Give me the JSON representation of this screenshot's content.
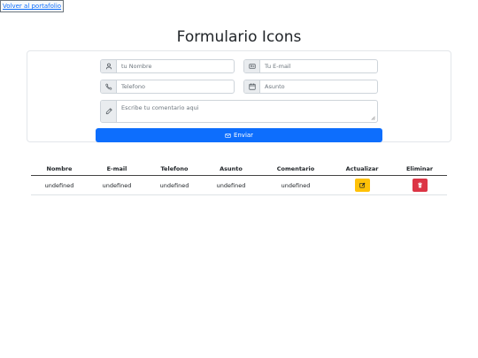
{
  "nav": {
    "back_label": "Volver al portafolio"
  },
  "page": {
    "title": "Formulario Icons"
  },
  "form": {
    "name_placeholder": "tu Nombre",
    "email_placeholder": "Tu E-mail",
    "phone_placeholder": "Telefono",
    "subject_placeholder": "Asunto",
    "comment_placeholder": "Escribe tu comentario aqui",
    "submit_label": "Enviar",
    "icons": {
      "name": "user-icon",
      "email": "envelope-card-icon",
      "phone": "phone-icon",
      "subject": "calendar-icon",
      "comment": "pencil-icon",
      "submit": "envelope-icon"
    }
  },
  "table": {
    "headers": [
      "Nombre",
      "E-mail",
      "Telefono",
      "Asunto",
      "Comentario",
      "Actualizar",
      "Eliminar"
    ],
    "rows": [
      {
        "nombre": "undefined",
        "email": "undefined",
        "telefono": "undefined",
        "asunto": "undefined",
        "comentario": "undefined",
        "update_icon": "edit-icon",
        "delete_icon": "trash-icon"
      }
    ]
  },
  "colors": {
    "primary": "#0d6efd",
    "warning": "#ffc107",
    "danger": "#dc3545"
  }
}
